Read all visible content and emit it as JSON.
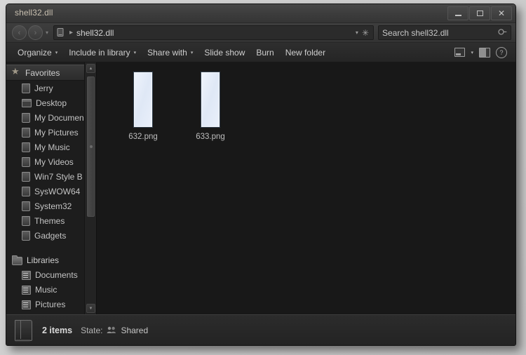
{
  "window": {
    "title": "shell32.dll",
    "controls": {
      "minimize": "–",
      "maximize": "□",
      "close": "✕"
    }
  },
  "navbar": {
    "back_glyph": "‹",
    "forward_glyph": "›",
    "history_glyph": "▾",
    "breadcrumb_icon": "computer-icon",
    "breadcrumb_separator": "▸",
    "path": "shell32.dll",
    "dropdown_glyph": "▾",
    "refresh_glyph": "✳",
    "search": {
      "placeholder": "Search shell32.dll",
      "value": "Search shell32.dll",
      "icon_glyph": "⚲"
    }
  },
  "toolbar": {
    "items": [
      {
        "label": "Organize",
        "has_caret": true
      },
      {
        "label": "Include in library",
        "has_caret": true
      },
      {
        "label": "Share with",
        "has_caret": true
      },
      {
        "label": "Slide show",
        "has_caret": false
      },
      {
        "label": "Burn",
        "has_caret": false
      },
      {
        "label": "New folder",
        "has_caret": false
      }
    ],
    "caret_glyph": "▾",
    "right_icons": [
      {
        "name": "change-view-icon"
      },
      {
        "name": "change-view-caret-icon",
        "glyph": "▾"
      },
      {
        "name": "preview-pane-icon"
      },
      {
        "name": "help-icon",
        "glyph": "?"
      }
    ]
  },
  "sidebar": {
    "groups": [
      {
        "header": {
          "label": "Favorites",
          "icon": "star-icon",
          "selected": true
        },
        "items": [
          {
            "label": "Jerry",
            "icon": "folder-small-icon"
          },
          {
            "label": "Desktop",
            "icon": "desktop-icon"
          },
          {
            "label": "My Documen",
            "icon": "folder-small-icon"
          },
          {
            "label": "My Pictures",
            "icon": "folder-small-icon"
          },
          {
            "label": "My Music",
            "icon": "folder-small-icon"
          },
          {
            "label": "My Videos",
            "icon": "folder-small-icon"
          },
          {
            "label": "Win7 Style B",
            "icon": "folder-small-icon"
          },
          {
            "label": "SysWOW64",
            "icon": "folder-small-icon"
          },
          {
            "label": "System32",
            "icon": "folder-small-icon"
          },
          {
            "label": "Themes",
            "icon": "folder-small-icon"
          },
          {
            "label": "Gadgets",
            "icon": "folder-small-icon"
          }
        ]
      },
      {
        "header": {
          "label": "Libraries",
          "icon": "folder-icon",
          "selected": false
        },
        "items": [
          {
            "label": "Documents",
            "icon": "library-icon"
          },
          {
            "label": "Music",
            "icon": "library-icon"
          },
          {
            "label": "Pictures",
            "icon": "library-icon"
          }
        ]
      }
    ],
    "scrollbar": {
      "up_glyph": "▲",
      "down_glyph": "▼"
    }
  },
  "content": {
    "files": [
      {
        "name": "632.png",
        "icon": "image-thumbnail"
      },
      {
        "name": "633.png",
        "icon": "image-thumbnail"
      }
    ]
  },
  "statusbar": {
    "folder_icon": "folder-large-icon",
    "item_count": "2 items",
    "state_label": "State:",
    "shared_icon": "shared-people-icon",
    "shared_glyph": "⚇",
    "state_value": "Shared"
  }
}
